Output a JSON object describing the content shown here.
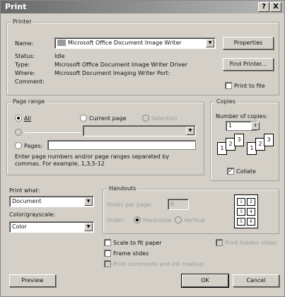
{
  "title": "Print",
  "title_buttons": {
    "help": "?",
    "close": "X"
  },
  "printer": {
    "section_label": "Printer",
    "name_label": "Name:",
    "name_value": "Microsoft Office Document Image Writer",
    "status_label": "Status:",
    "status_value": "Idle",
    "type_label": "Type:",
    "type_value": "Microsoft Office Document Image Writer Driver",
    "where_label": "Where:",
    "where_value": "Microsoft Document Imaging Writer Port:",
    "comment_label": "Comment:",
    "properties_button": "Properties",
    "find_printer_button": "Find Printer...",
    "print_to_file_label": "Print to file"
  },
  "page_range": {
    "section_label": "Page range",
    "all_label": "All",
    "current_page_label": "Current page",
    "selection_label": "Selection",
    "pages_label": "Pages:",
    "hint": "Enter page numbers and/or page ranges separated by commas. For example, 1,3,5-12"
  },
  "copies": {
    "section_label": "Copies",
    "number_label": "Number of copies:",
    "number_value": "1",
    "collate_label": "Collate"
  },
  "print_what": {
    "label": "Print what:",
    "value": "Document"
  },
  "color_grayscale": {
    "label": "Color/grayscale:",
    "value": "Color"
  },
  "handouts": {
    "section_label": "Handouts",
    "slides_per_page_label": "Slides per page:",
    "slides_per_page_value": "6",
    "order_label": "Order:",
    "horizontal_label": "Horizontal",
    "vertical_label": "Vertical",
    "thumbs": [
      "1",
      "2",
      "3",
      "4",
      "5",
      "6"
    ]
  },
  "options": {
    "scale_label": "Scale to fit paper",
    "frame_label": "Frame slides",
    "comments_label": "Print comments and ink markup",
    "hidden_label": "Print hidden slides"
  },
  "buttons": {
    "preview": "Preview",
    "ok": "OK",
    "cancel": "Cancel"
  }
}
